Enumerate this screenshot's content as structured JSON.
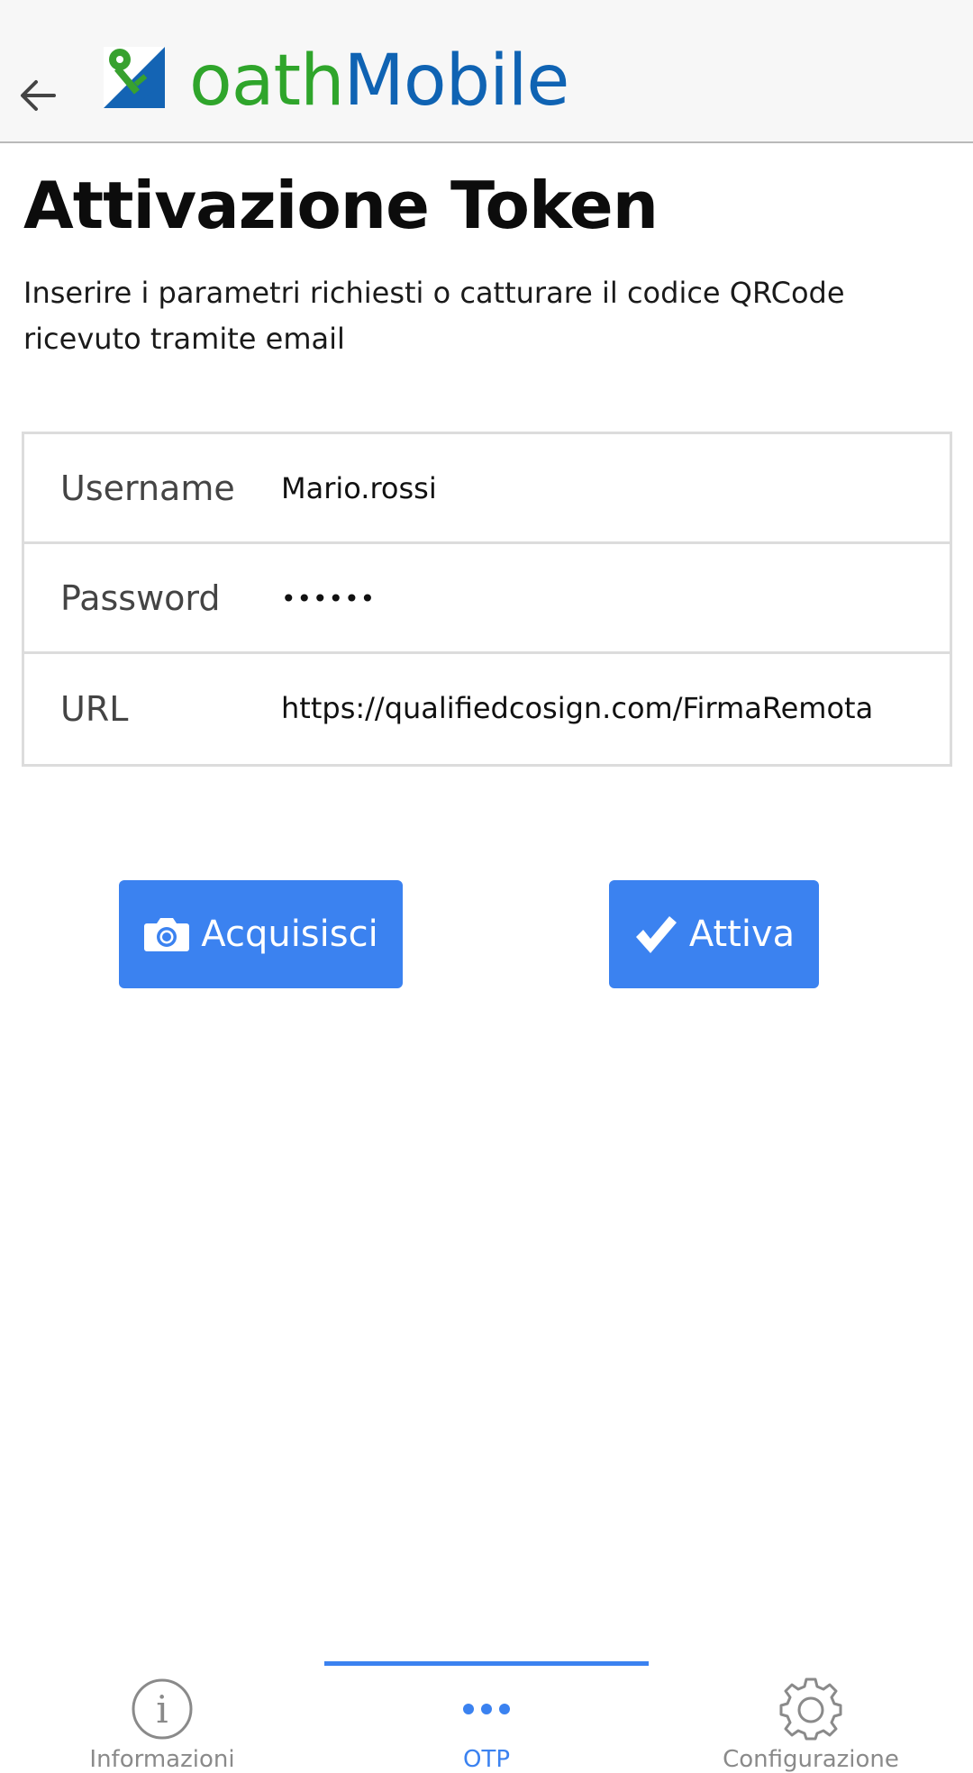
{
  "app": {
    "brand_part1": "oath",
    "brand_part2": "Mobile"
  },
  "page": {
    "title": "Attivazione Token",
    "description": "Inserire i parametri richiesti o catturare il codice QRCode ricevuto tramite email"
  },
  "form": {
    "username_label": "Username",
    "username_value": "Mario.rossi",
    "password_label": "Password",
    "password_value": "••••••",
    "url_label": "URL",
    "url_value": "https://qualifiedcosign.com/FirmaRemota"
  },
  "buttons": {
    "acquire_label": "Acquisisci",
    "activate_label": "Attiva"
  },
  "tabs": [
    {
      "label": "Informazioni",
      "icon": "info-icon"
    },
    {
      "label": "OTP",
      "icon": "more-dots-icon",
      "active": true
    },
    {
      "label": "Configurazione",
      "icon": "gear-icon"
    }
  ],
  "colors": {
    "accent": "#3b82f0",
    "brand_green": "#2fa52b",
    "brand_blue": "#0f63b3",
    "topbar_bg": "#f7f7f7"
  }
}
